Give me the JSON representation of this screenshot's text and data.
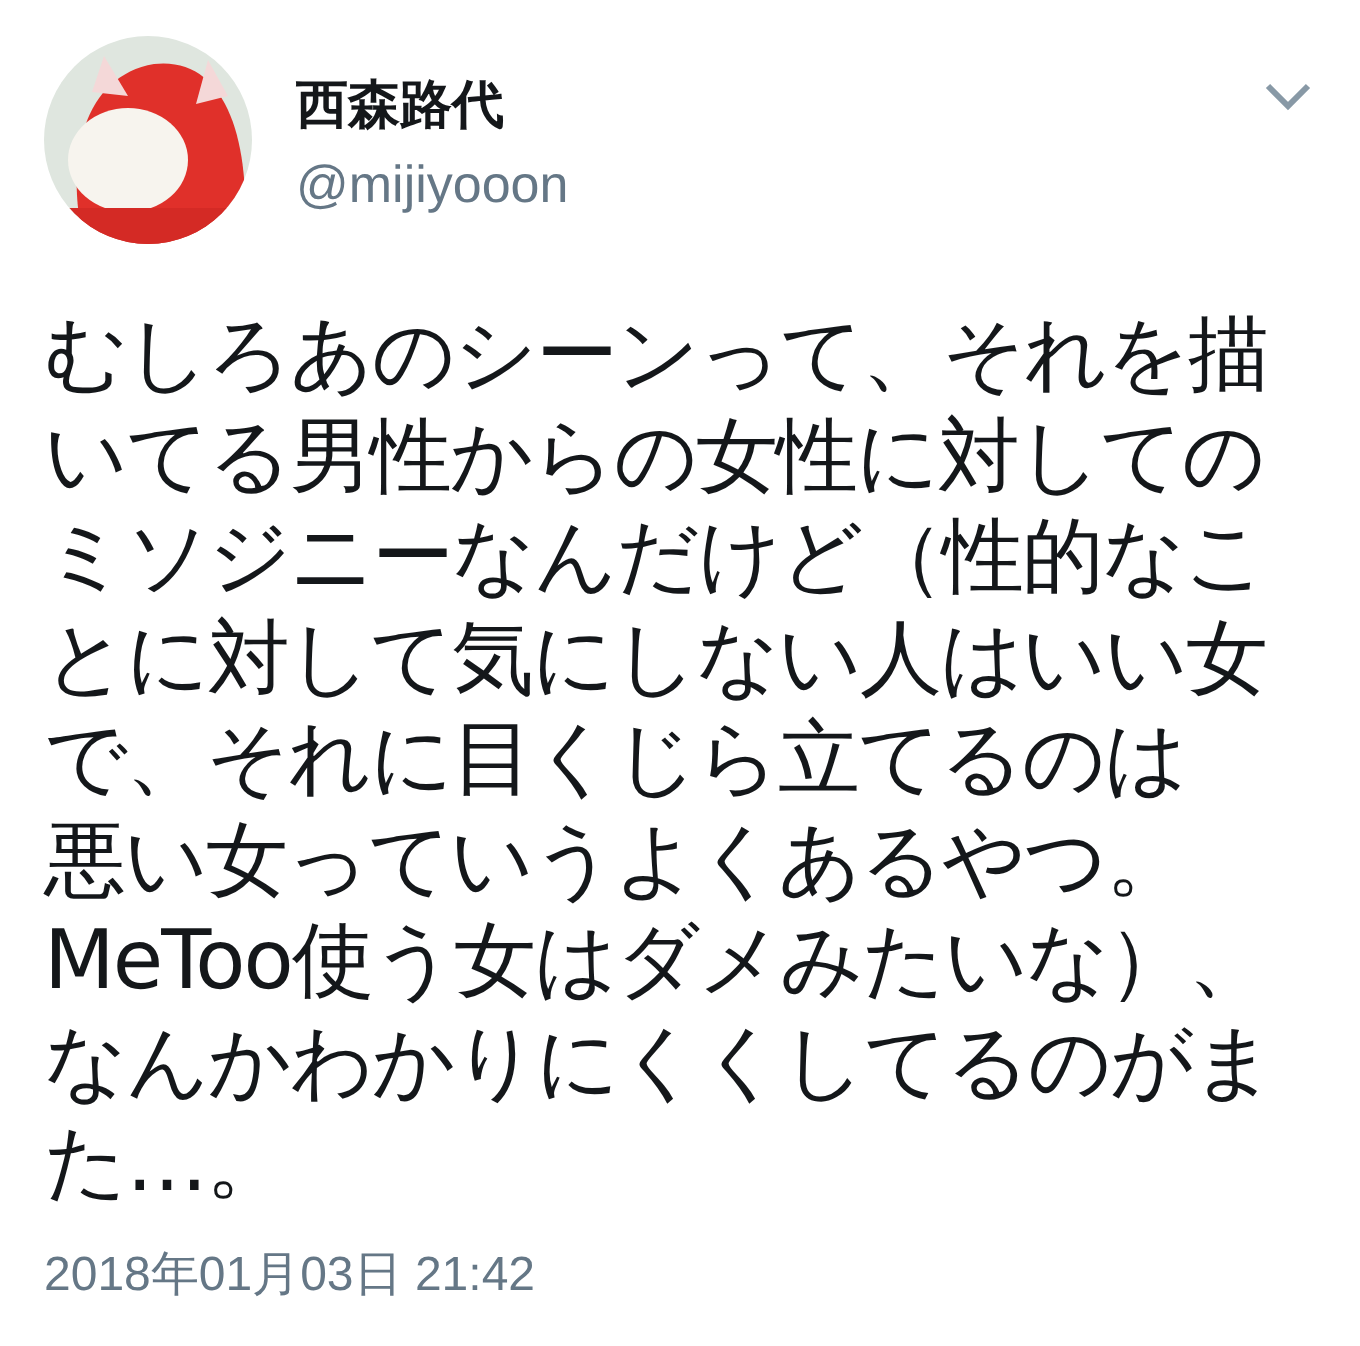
{
  "tweet": {
    "display_name": "西森路代",
    "handle": "@mijiyooon",
    "body_lines": [
      "むしろあのシーンって、それを描",
      "いてる男性からの女性に対しての",
      "ミソジニーなんだけど（性的なこ",
      "とに対して気にしない人はいい女",
      "で、それに目くじら立てるのは",
      "悪い女っていうよくあるやつ。",
      "MeToo使う女はダメみたいな）、",
      "なんかわかりにくくしてるのがま",
      "た…。"
    ],
    "timestamp": "2018年01月03日 21:42"
  }
}
